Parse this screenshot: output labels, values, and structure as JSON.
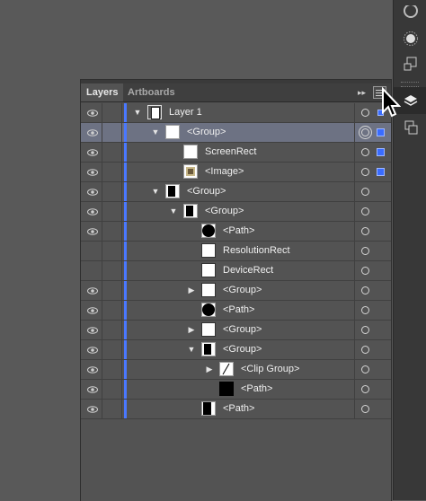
{
  "panel": {
    "tabs": [
      {
        "label": "Layers"
      },
      {
        "label": "Artboards"
      }
    ],
    "collapse_glyph": "▸▸"
  },
  "colors": {
    "layer_color": "#4a78ff",
    "selected_row": "#6d7283",
    "selection_square": "#3a6cff"
  },
  "rows": [
    {
      "name": "Layer 1",
      "eye": true,
      "depth": 0,
      "arrow": "down",
      "thumb": "layer",
      "selected": false,
      "target_selected": false,
      "selection": "small"
    },
    {
      "name": "<Group>",
      "eye": true,
      "depth": 1,
      "arrow": "down",
      "thumb": "white",
      "selected": true,
      "target_selected": true,
      "selection": "large"
    },
    {
      "name": "ScreenRect",
      "eye": true,
      "depth": 2,
      "arrow": "",
      "thumb": "white",
      "selected": false,
      "target_selected": false,
      "selection": "large"
    },
    {
      "name": "<Image>",
      "eye": true,
      "depth": 2,
      "arrow": "",
      "thumb": "image",
      "selected": false,
      "target_selected": false,
      "selection": "large"
    },
    {
      "name": "<Group>",
      "eye": true,
      "depth": 1,
      "arrow": "down",
      "thumb": "group-black",
      "selected": false,
      "target_selected": false,
      "selection": ""
    },
    {
      "name": "<Group>",
      "eye": true,
      "depth": 2,
      "arrow": "down",
      "thumb": "group-black",
      "selected": false,
      "target_selected": false,
      "selection": ""
    },
    {
      "name": "<Path>",
      "eye": true,
      "depth": 3,
      "arrow": "",
      "thumb": "circle",
      "selected": false,
      "target_selected": false,
      "selection": ""
    },
    {
      "name": "ResolutionRect",
      "eye": false,
      "depth": 3,
      "arrow": "",
      "thumb": "white-bordered",
      "selected": false,
      "target_selected": false,
      "selection": ""
    },
    {
      "name": "DeviceRect",
      "eye": false,
      "depth": 3,
      "arrow": "",
      "thumb": "white-bordered",
      "selected": false,
      "target_selected": false,
      "selection": ""
    },
    {
      "name": "<Group>",
      "eye": true,
      "depth": 3,
      "arrow": "right",
      "thumb": "white-bordered",
      "selected": false,
      "target_selected": false,
      "selection": ""
    },
    {
      "name": "<Path>",
      "eye": true,
      "depth": 3,
      "arrow": "",
      "thumb": "circle",
      "selected": false,
      "target_selected": false,
      "selection": ""
    },
    {
      "name": "<Group>",
      "eye": true,
      "depth": 3,
      "arrow": "right",
      "thumb": "white-bordered",
      "selected": false,
      "target_selected": false,
      "selection": ""
    },
    {
      "name": "<Group>",
      "eye": true,
      "depth": 3,
      "arrow": "down",
      "thumb": "group-black",
      "selected": false,
      "target_selected": false,
      "selection": ""
    },
    {
      "name": "<Clip Group>",
      "eye": true,
      "depth": 4,
      "arrow": "right",
      "thumb": "clip",
      "selected": false,
      "target_selected": false,
      "selection": ""
    },
    {
      "name": "<Path>",
      "eye": true,
      "depth": 4,
      "arrow": "",
      "thumb": "black",
      "selected": false,
      "target_selected": false,
      "selection": ""
    },
    {
      "name": "<Path>",
      "eye": true,
      "depth": 3,
      "arrow": "",
      "thumb": "bar",
      "selected": false,
      "target_selected": false,
      "selection": ""
    }
  ],
  "toolbar": {
    "tools": [
      {
        "icon": "color-wheel-icon"
      },
      {
        "icon": "brightness-icon"
      },
      {
        "icon": "transform-icon"
      },
      {
        "icon": "layers-icon"
      },
      {
        "icon": "artboards-icon"
      }
    ]
  }
}
